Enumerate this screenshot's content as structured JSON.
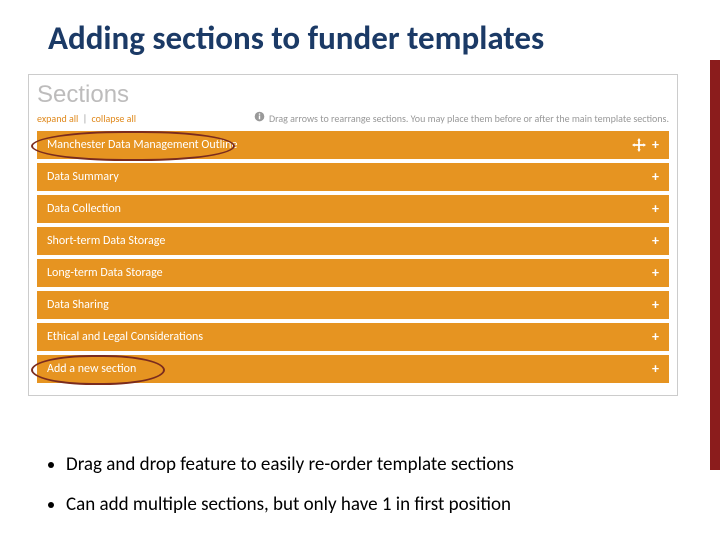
{
  "title": "Adding sections to funder templates",
  "panel": {
    "heading": "Sections",
    "expand": "expand all",
    "collapse": "collapse all",
    "hint": "Drag arrows to rearrange sections. You may place them before or after the main template sections."
  },
  "sections": [
    "Manchester Data Management Outline",
    "Data Summary",
    "Data Collection",
    "Short-term Data Storage",
    "Long-term Data Storage",
    "Data Sharing",
    "Ethical and Legal Considerations"
  ],
  "add_label": "Add a new section",
  "bullets": [
    "Drag and drop feature to easily re-order template sections",
    "Can add multiple sections, but only have 1 in first position"
  ]
}
